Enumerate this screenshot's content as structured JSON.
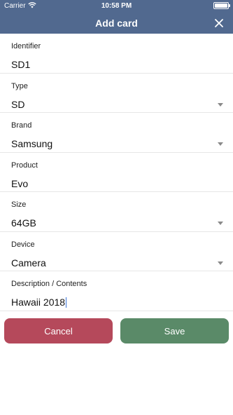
{
  "status_bar": {
    "carrier": "Carrier",
    "time": "10:58 PM",
    "battery_level": 1.0
  },
  "header": {
    "title": "Add card",
    "background": "#51698f",
    "close_icon": "close-icon"
  },
  "fields": [
    {
      "label": "Identifier",
      "value": "SD1",
      "dropdown": false
    },
    {
      "label": "Type",
      "value": "SD",
      "dropdown": true
    },
    {
      "label": "Brand",
      "value": "Samsung",
      "dropdown": true
    },
    {
      "label": "Product",
      "value": "Evo",
      "dropdown": false
    },
    {
      "label": "Size",
      "value": "64GB",
      "dropdown": true
    },
    {
      "label": "Device",
      "value": "Camera",
      "dropdown": true
    },
    {
      "label": "Description / Contents",
      "value": "Hawaii 2018",
      "dropdown": false,
      "focused": true
    }
  ],
  "actions": {
    "cancel": {
      "label": "Cancel",
      "color": "#b5495b"
    },
    "save": {
      "label": "Save",
      "color": "#5a8a68"
    }
  }
}
